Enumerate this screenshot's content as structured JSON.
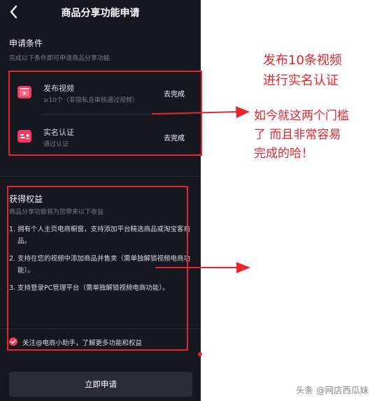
{
  "header": {
    "title": "商品分享功能申请",
    "back_icon": "back-arrow-icon"
  },
  "conditions": {
    "title": "申请条件",
    "subtitle": "完成以下条件即可申请商品分享功能",
    "items": [
      {
        "name": "发布视频",
        "desc": "≥10个（非隐私且审核通过视频）",
        "action": "去完成",
        "icon": "video-clapper-icon"
      },
      {
        "name": "实名认证",
        "desc": "通过认证",
        "action": "去完成",
        "icon": "id-card-icon"
      }
    ]
  },
  "benefits": {
    "title": "获得权益",
    "subtitle": "商品分享功能将为您带来以下收益",
    "items": [
      {
        "num": "1.",
        "text": "拥有个人主页电商橱窗，支持添加平台精选商品或淘宝客商品。"
      },
      {
        "num": "2.",
        "text": "支持在您的视频中添加商品并售卖（需单独解锁视频电商功能）。"
      },
      {
        "num": "3.",
        "text": "支持登录PC管理平台（需单独解锁视频电商功能）。"
      }
    ]
  },
  "follow": {
    "text": "关注@电商小助手，了解更多功能和权益",
    "checked": true
  },
  "apply_button": {
    "label": "立即申请"
  },
  "annotations": {
    "top_line1": "发布10条视频",
    "top_line2": "进行实名认证",
    "mid_line1": "如今就这两个门槛",
    "mid_line2": "了 而且非常容易",
    "mid_line3": "完成的哈！"
  },
  "watermark": "头条 @网店西瓜妹",
  "colors": {
    "background": "#16171f",
    "accent": "#f03a5f",
    "annotation_red": "#e8242c",
    "button": "#2b2c35"
  }
}
